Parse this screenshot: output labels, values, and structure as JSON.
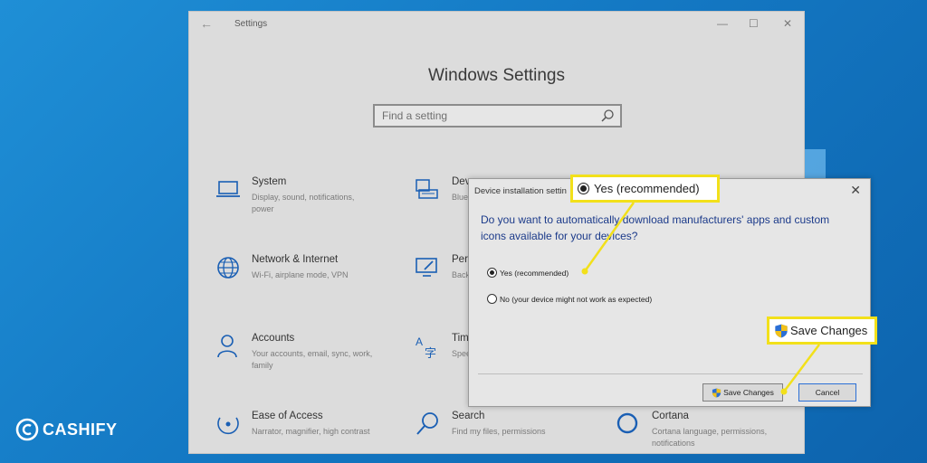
{
  "window": {
    "title": "Settings",
    "back_icon": "back-arrow-icon"
  },
  "page_title": "Windows Settings",
  "search": {
    "placeholder": "Find a setting"
  },
  "tiles": [
    {
      "title": "System",
      "desc": "Display, sound, notifications, power",
      "icon": "laptop-icon"
    },
    {
      "title": "Dev",
      "desc": "Blue",
      "icon": "devices-icon"
    },
    {
      "title": "Network & Internet",
      "desc": "Wi-Fi, airplane mode, VPN",
      "icon": "globe-icon"
    },
    {
      "title": "Pers",
      "desc": "Back",
      "icon": "personalization-icon"
    },
    {
      "title": "Accounts",
      "desc": "Your accounts, email, sync, work, family",
      "icon": "person-icon"
    },
    {
      "title": "Tim",
      "desc": "Spee",
      "icon": "time-language-icon"
    },
    {
      "title": "Ease of Access",
      "desc": "Narrator, magnifier, high contrast",
      "icon": "ease-of-access-icon"
    },
    {
      "title": "Search",
      "desc": "Find my files, permissions",
      "icon": "search-icon"
    },
    {
      "title": "Cortana",
      "desc": "Cortana language, permissions, notifications",
      "icon": "cortana-icon"
    }
  ],
  "dialog": {
    "title": "Device installation settin",
    "question": "Do you want to automatically download manufacturers' apps and custom icons available for your devices?",
    "options": [
      {
        "label": "Yes (recommended)",
        "selected": true
      },
      {
        "label": "No (your device might not work as expected)",
        "selected": false
      }
    ],
    "save_label": "Save Changes",
    "cancel_label": "Cancel"
  },
  "callouts": {
    "yes": "Yes (recommended)",
    "save": "Save Changes",
    "color": "#f2e01a"
  },
  "logo": "CASHIFY"
}
